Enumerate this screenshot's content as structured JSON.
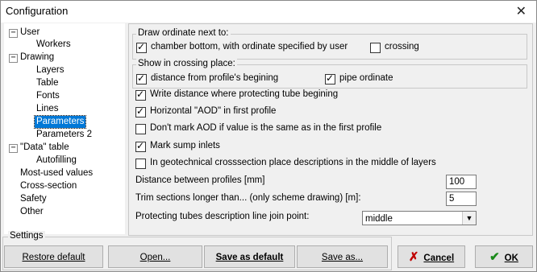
{
  "window": {
    "title": "Configuration"
  },
  "tree": {
    "items": [
      {
        "label": "User",
        "expander": "−"
      },
      {
        "label": "Workers"
      },
      {
        "label": "Drawing",
        "expander": "−"
      },
      {
        "label": "Layers"
      },
      {
        "label": "Table"
      },
      {
        "label": "Fonts"
      },
      {
        "label": "Lines"
      },
      {
        "label": "Parameters",
        "selected": true
      },
      {
        "label": "Parameters 2"
      },
      {
        "label": "\"Data\" table",
        "expander": "−"
      },
      {
        "label": "Autofilling"
      },
      {
        "label": "Most-used values"
      },
      {
        "label": "Cross-section"
      },
      {
        "label": "Safety"
      },
      {
        "label": "Other"
      }
    ]
  },
  "ordinate_group": {
    "title": "Draw ordinate next to:",
    "chamber_bottom": {
      "label": "chamber bottom, with ordinate specified by user",
      "checked": true
    },
    "crossing": {
      "label": "crossing",
      "checked": false
    }
  },
  "crossing_group": {
    "title": "Show in crossing place:",
    "distance": {
      "label": "distance from profile's begining",
      "checked": true
    },
    "pipe_ordinate": {
      "label": "pipe ordinate",
      "checked": true
    }
  },
  "options": {
    "write_distance": {
      "label": "Write distance where protecting tube begining",
      "checked": true
    },
    "horizontal_aod": {
      "label": "Horizontal \"AOD\" in first profile",
      "checked": true
    },
    "dont_mark_aod": {
      "label": "Don't mark AOD if value is the same as in the first profile",
      "checked": false
    },
    "mark_sump": {
      "label": "Mark sump inlets",
      "checked": true
    },
    "geotechnical": {
      "label": "In geotechnical crosssection place descriptions in the middle of layers",
      "checked": false
    }
  },
  "fields": {
    "distance_between": {
      "label": "Distance between profiles [mm]",
      "value": "100"
    },
    "trim_sections": {
      "label": "Trim sections longer than... (only scheme drawing) [m]:",
      "value": "5"
    },
    "join_point": {
      "label": "Protecting tubes description line join point:",
      "value": "middle"
    }
  },
  "settings": {
    "title": "Settings",
    "restore_default": "Restore default",
    "open": "Open...",
    "save_as_default": "Save as default",
    "save_as": "Save as..."
  },
  "actions": {
    "cancel": "Cancel",
    "ok": "OK"
  },
  "colors": {
    "selection": "#0078d7",
    "cancel_icon": "#c00000",
    "ok_icon": "#1a8a1a"
  }
}
